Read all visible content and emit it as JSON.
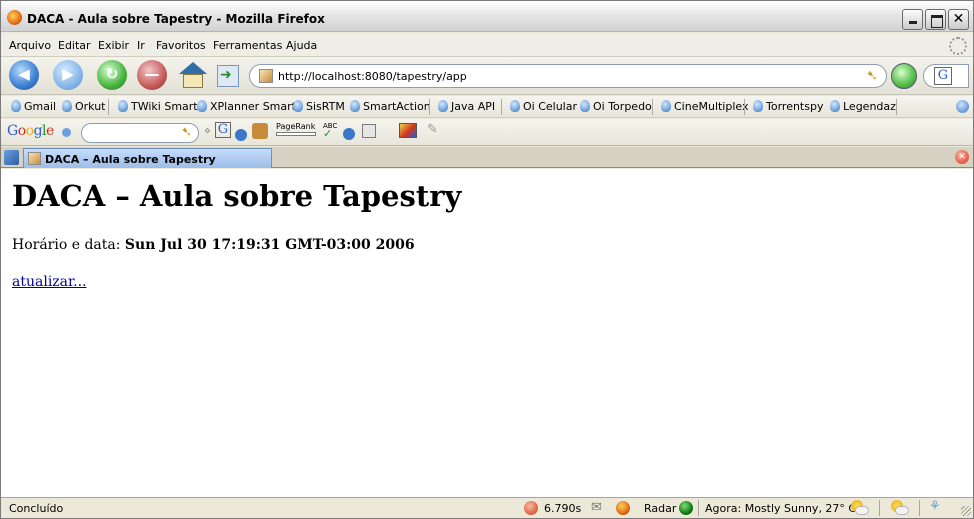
{
  "window": {
    "title": "DACA - Aula sobre Tapestry - Mozilla Firefox"
  },
  "menu": {
    "items": [
      "Arquivo",
      "Editar",
      "Exibir",
      "Ir",
      "Favoritos",
      "Ferramentas",
      "Ajuda"
    ]
  },
  "navigation": {
    "url": "http://localhost:8080/tapestry/app",
    "search_engine_letter": "G"
  },
  "bookmarks": [
    "Gmail",
    "Orkut",
    "TWiki Smart",
    "XPlanner Smart",
    "SisRTM",
    "SmartAction",
    "Java API",
    "Oi Celular",
    "Oi Torpedo",
    "CineMultiplex",
    "Torrentspy",
    "Legendaz"
  ],
  "google_toolbar": {
    "logo": "Google",
    "pagerank_label": "PageRank",
    "spell_label": "ABC",
    "g_letter": "G"
  },
  "tab": {
    "label": "DACA – Aula sobre Tapestry"
  },
  "page": {
    "heading": "DACA – Aula sobre Tapestry",
    "datetime_label": "Horário e data:",
    "datetime_value": "Sun Jul 30 17:19:31 GMT-03:00 2006",
    "refresh_link": "atualizar..."
  },
  "status": {
    "text": "Concluído",
    "load_time": "6.790s",
    "radar": "Radar",
    "weather": "Agora: Mostly Sunny, 27° C"
  },
  "colors": {
    "link": "#00009c",
    "tab_active": "#9dbde9",
    "chrome": "#ece9d8"
  }
}
